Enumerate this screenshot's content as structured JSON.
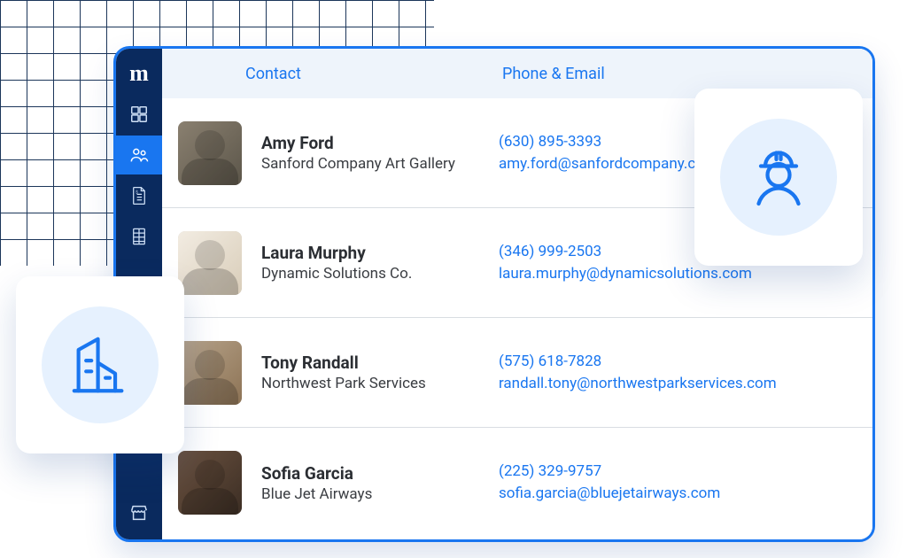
{
  "header": {
    "columns": {
      "contact": "Contact",
      "phone_email": "Phone & Email"
    }
  },
  "sidebar": {
    "logo_text": "m",
    "items": [
      {
        "icon": "dashboard-icon",
        "active": false
      },
      {
        "icon": "people-icon",
        "active": true
      },
      {
        "icon": "document-icon",
        "active": false
      },
      {
        "icon": "spreadsheet-icon",
        "active": false
      }
    ],
    "bottom_item": {
      "icon": "storefront-icon"
    }
  },
  "contacts": [
    {
      "name": "Amy Ford",
      "company": "Sanford Company Art Gallery",
      "phone": "(630) 895-3393",
      "email": "amy.ford@sanfordcompany.com"
    },
    {
      "name": "Laura Murphy",
      "company": "Dynamic Solutions Co.",
      "phone": "(346) 999-2503",
      "email": "laura.murphy@dynamicsolutions.com"
    },
    {
      "name": "Tony Randall",
      "company": "Northwest Park Services",
      "phone": "(575) 618-7828",
      "email": "randall.tony@northwestparkservices.com"
    },
    {
      "name": "Sofia Garcia",
      "company": "Blue Jet Airways",
      "phone": "(225) 329-9757",
      "email": "sofia.garcia@bluejetairways.com"
    }
  ]
}
